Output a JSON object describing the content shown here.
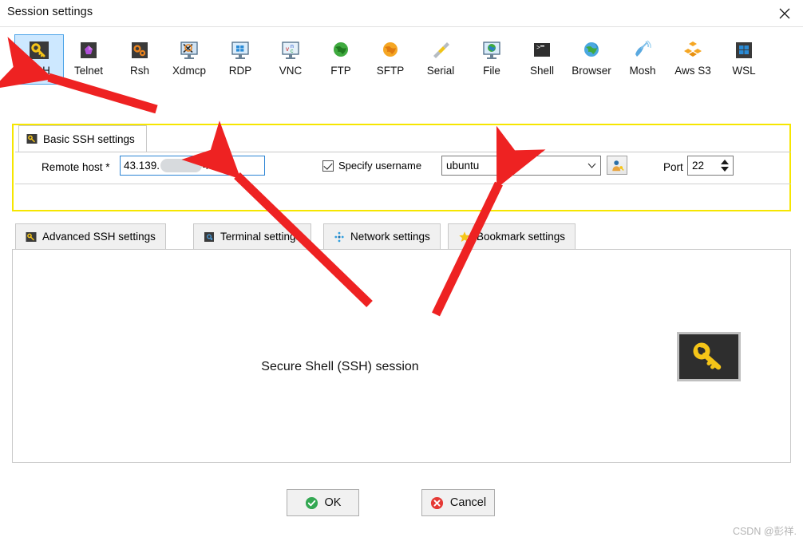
{
  "window": {
    "title": "Session settings",
    "close_icon": "close-icon"
  },
  "toolbar": {
    "protocols": [
      {
        "label": "SSH",
        "icon": "ssh-key-icon",
        "selected": true
      },
      {
        "label": "Telnet",
        "icon": "telnet-gem-icon",
        "selected": false
      },
      {
        "label": "Rsh",
        "icon": "rsh-gears-icon",
        "selected": false
      },
      {
        "label": "Xdmcp",
        "icon": "xdmcp-monitor-icon",
        "selected": false
      },
      {
        "label": "RDP",
        "icon": "rdp-windows-monitor-icon",
        "selected": false
      },
      {
        "label": "VNC",
        "icon": "vnc-monitor-icon",
        "selected": false
      },
      {
        "label": "FTP",
        "icon": "ftp-green-globe-icon",
        "selected": false
      },
      {
        "label": "SFTP",
        "icon": "sftp-orange-globe-icon",
        "selected": false
      },
      {
        "label": "Serial",
        "icon": "serial-plug-icon",
        "selected": false
      },
      {
        "label": "File",
        "icon": "file-globe-monitor-icon",
        "selected": false
      },
      {
        "label": "Shell",
        "icon": "shell-terminal-icon",
        "selected": false
      },
      {
        "label": "Browser",
        "icon": "browser-globe-icon",
        "selected": false
      },
      {
        "label": "Mosh",
        "icon": "mosh-satellite-icon",
        "selected": false
      },
      {
        "label": "Aws S3",
        "icon": "aws-s3-cubes-icon",
        "selected": false
      },
      {
        "label": "WSL",
        "icon": "wsl-windows-icon",
        "selected": false
      }
    ]
  },
  "basic_settings": {
    "tab_label": "Basic SSH settings",
    "tab_icon": "ssh-key-icon",
    "remote_host": {
      "label": "Remote host *",
      "value_prefix": "43.139.",
      "value_suffix": "4",
      "redacted": true
    },
    "specify_username": {
      "label": "Specify username",
      "checked": true
    },
    "username": {
      "value": "ubuntu",
      "dropdown_icon": "chevron-down-icon"
    },
    "user_picker_icon": "user-key-icon",
    "port": {
      "label": "Port",
      "value": "22"
    }
  },
  "lower_tabs": [
    {
      "label": "Advanced SSH settings",
      "icon": "ssh-key-icon"
    },
    {
      "label": "Terminal settings",
      "icon": "terminal-gear-icon"
    },
    {
      "label": "Network settings",
      "icon": "network-nodes-icon"
    },
    {
      "label": "Bookmark settings",
      "icon": "star-icon"
    }
  ],
  "panel": {
    "caption": "Secure Shell (SSH) session",
    "logo_icon": "ssh-key-large-icon"
  },
  "footer": {
    "ok_label": "OK",
    "ok_icon": "check-circle-icon",
    "cancel_label": "Cancel",
    "cancel_icon": "x-circle-icon"
  },
  "watermark": "CSDN @彭祥.",
  "colors": {
    "highlight_yellow": "#f6e600",
    "selection_blue": "#cde8ff",
    "annotation_red": "#ee2222",
    "focus_border": "#2b84d4"
  }
}
